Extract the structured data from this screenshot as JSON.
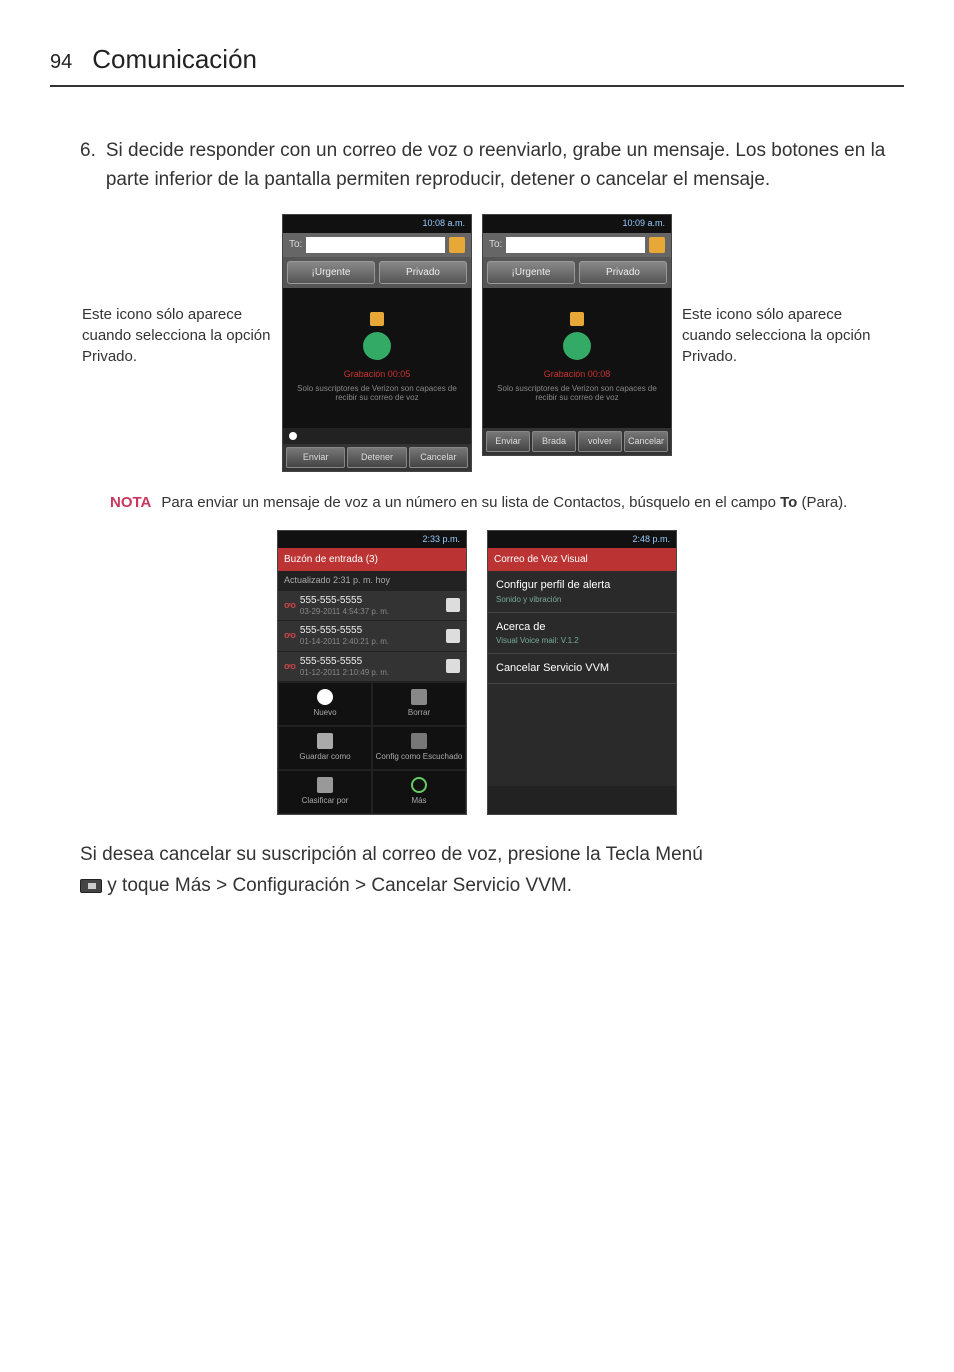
{
  "header": {
    "pageNumber": "94",
    "title": "Comunicación"
  },
  "step": {
    "number": "6.",
    "text": "Si decide responder con un correo de voz o reenviarlo, grabe un mensaje. Los botones en la parte inferior de la pantalla permiten reproducir, detener o cancelar el mensaje."
  },
  "annotation": {
    "left": "Este icono sólo aparece cuando selecciona la opción Privado.",
    "right": "Este icono sólo aparece cuando selecciona la opción Privado."
  },
  "phoneA": {
    "time": "10:08 a.m.",
    "to": "To:",
    "urgente": "¡Urgente",
    "privado": "Privado",
    "recLabel": "Grabación 00:05",
    "recNote": "Solo suscriptores de Verizon son capaces de recibir su correo de voz",
    "btns": [
      "Enviar",
      "Detener",
      "Cancelar"
    ]
  },
  "phoneB": {
    "time": "10:09 a.m.",
    "to": "To:",
    "urgente": "¡Urgente",
    "privado": "Privado",
    "recLabel": "Grabación 00:08",
    "recNote": "Solo suscriptores de Verizon son capaces de recibir su correo de voz",
    "btns": [
      "Enviar",
      "Brada",
      "volver",
      "Cancelar"
    ]
  },
  "nota": {
    "label": "NOTA",
    "prefix": "Para enviar un mensaje de voz a un número en su lista de Contactos, búsquelo en el campo ",
    "to": "To",
    "para": " (Para)."
  },
  "inbox": {
    "time": "2:33 p.m.",
    "title": "Buzón de entrada (3)",
    "updated": "Actualizado 2:31 p. m. hoy",
    "items": [
      {
        "num": "555-555-5555",
        "date": "03-29-2011 4:54:37 p. m."
      },
      {
        "num": "555-555-5555",
        "date": "01-14-2011 2:40:21 p. m."
      },
      {
        "num": "555-555-5555",
        "date": "01-12-2011 2:10:49 p. m."
      }
    ],
    "grid": [
      "Nuevo",
      "Borrar",
      "Guardar como",
      "Config como Escuchado",
      "Clasificar por",
      "Más"
    ]
  },
  "menu": {
    "time": "2:48 p.m.",
    "title": "Correo de Voz Visual",
    "items": [
      {
        "t": "Configur perfil de alerta",
        "s": "Sonido y vibración"
      },
      {
        "t": "Acerca de",
        "s": "Visual Voice mail: V.1.2"
      },
      {
        "t": "Cancelar Servicio VVM",
        "s": ""
      }
    ]
  },
  "final": {
    "p1a": "Si desea cancelar su suscripción al correo de voz, presione la ",
    "p1b": "Tecla Menú",
    "p2a": " y toque ",
    "p2b": "Más",
    "p2c": " > ",
    "p2d": "Configuración",
    "p2e": " > ",
    "p2f": "Cancelar Servicio VVM",
    "p2g": "."
  }
}
